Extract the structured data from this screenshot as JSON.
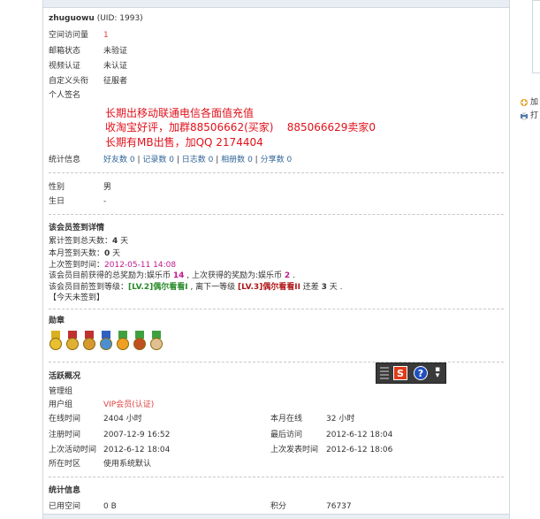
{
  "profile": {
    "username": "zhuguowu",
    "uid_text": "(UID: 1993)",
    "fields": [
      {
        "label": "空间访问量",
        "value": "1"
      },
      {
        "label": "邮箱状态",
        "value": "未验证"
      },
      {
        "label": "视频认证",
        "value": "未认证"
      },
      {
        "label": "自定义头衔",
        "value": "征服者"
      },
      {
        "label": "个人签名",
        "value": ""
      }
    ],
    "signature": [
      "长期出移动联通电信各面值充值",
      "收淘宝好评，加群88506662(买家)    885066629卖家0",
      "长期有MB出售，加QQ 2174404"
    ],
    "stats": {
      "label": "统计信息",
      "items": [
        {
          "name": "好友数",
          "count": "0"
        },
        {
          "name": "记录数",
          "count": "0"
        },
        {
          "name": "日志数",
          "count": "0"
        },
        {
          "name": "相册数",
          "count": "0"
        },
        {
          "name": "分享数",
          "count": "0"
        }
      ]
    },
    "gender": {
      "label": "性别",
      "value": "男"
    },
    "birthday": {
      "label": "生日",
      "value": "-"
    }
  },
  "checkin": {
    "title": "该会员签到详情",
    "total_prefix": "累计签到总天数：",
    "total_days": "4",
    "total_suffix": " 天",
    "month_prefix": "本月签到天数：",
    "month_days": "0",
    "month_suffix": " 天",
    "last_prefix": "上次签到时间：",
    "last_time": "2012-05-11 14:08",
    "reward_prefix": "该会员目前获得的总奖励为:娱乐币 ",
    "reward_total": "14",
    "reward_mid": " , 上次获得的奖励为:娱乐币 ",
    "reward_last": "2",
    "reward_suffix": " .",
    "level_prefix": "该会员目前签到等级：",
    "level_current": "[LV.2]偶尔看看I",
    "level_mid": " , 离下一等级 ",
    "level_next": "[LV.3]偶尔看看II",
    "level_gap_prefix": " 还差 ",
    "level_gap": "3",
    "level_gap_suffix": " 天 .",
    "today": "【今天未签到】"
  },
  "medals": {
    "title": "勋章",
    "items": [
      {
        "icon": "gold-medal-icon",
        "ribbon": "#d8b020",
        "disc": "#e8c030"
      },
      {
        "icon": "gold-medal-icon",
        "ribbon": "#c03030",
        "disc": "#e0b030"
      },
      {
        "icon": "bronze-medal-icon",
        "ribbon": "#c03030",
        "disc": "#d89830"
      },
      {
        "icon": "globe-medal-icon",
        "ribbon": "#3060c0",
        "disc": "#4a90d0"
      },
      {
        "icon": "sun-medal-icon",
        "ribbon": "#40a040",
        "disc": "#f0a020"
      },
      {
        "icon": "flower-medal-icon",
        "ribbon": "#40a040",
        "disc": "#c05020"
      },
      {
        "icon": "avatar-medal-icon",
        "ribbon": "#40a040",
        "disc": "#e0c090"
      }
    ]
  },
  "activity": {
    "title": "活跃概况",
    "admin_group": {
      "label": "管理组",
      "value": ""
    },
    "user_group": {
      "label": "用户组",
      "value": "VIP会员(认证)"
    },
    "left": [
      {
        "label": "在线时间",
        "value": "2404 小时"
      },
      {
        "label": "注册时间",
        "value": "2007-12-9 16:52"
      },
      {
        "label": "上次活动时间",
        "value": "2012-6-12 18:04"
      },
      {
        "label": "所在时区",
        "value": "使用系统默认"
      }
    ],
    "right": [
      {
        "label": "本月在线",
        "value": "32 小时"
      },
      {
        "label": "最后访问",
        "value": "2012-6-12 18:04"
      },
      {
        "label": "上次发表时间",
        "value": "2012-6-12 18:06"
      }
    ]
  },
  "stats_info": {
    "title": "统计信息",
    "left": {
      "label": "已用空间",
      "value": "0 B"
    },
    "right": {
      "label": "积分",
      "value": "76737"
    }
  },
  "ime": {
    "s_label": "S",
    "help_label": "?"
  },
  "sidebar": {
    "items": [
      {
        "label": "加"
      },
      {
        "label": "打"
      }
    ]
  },
  "colors": {
    "accent_red": "#e04040",
    "link_blue": "#336699",
    "sig_red": "#e0101a"
  }
}
